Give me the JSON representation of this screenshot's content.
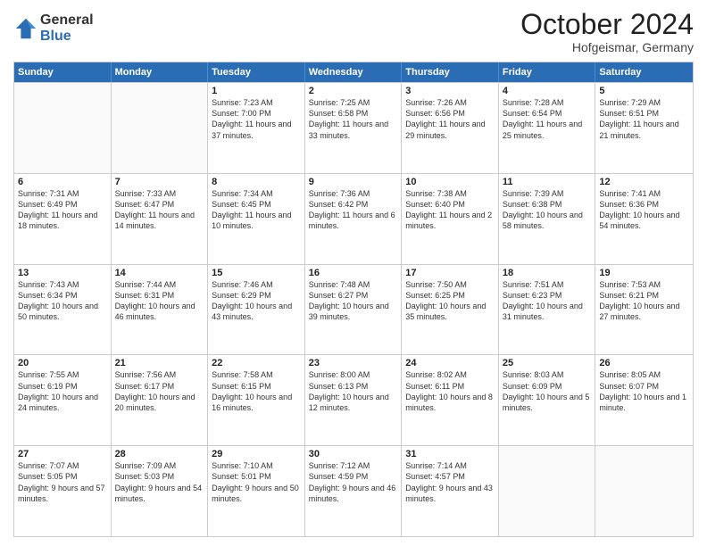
{
  "header": {
    "logo_general": "General",
    "logo_blue": "Blue",
    "title": "October 2024",
    "subtitle": "Hofgeismar, Germany"
  },
  "calendar": {
    "days_of_week": [
      "Sunday",
      "Monday",
      "Tuesday",
      "Wednesday",
      "Thursday",
      "Friday",
      "Saturday"
    ],
    "rows": [
      [
        {
          "day": "",
          "text": "",
          "empty": true
        },
        {
          "day": "",
          "text": "",
          "empty": true
        },
        {
          "day": "1",
          "text": "Sunrise: 7:23 AM\nSunset: 7:00 PM\nDaylight: 11 hours and 37 minutes."
        },
        {
          "day": "2",
          "text": "Sunrise: 7:25 AM\nSunset: 6:58 PM\nDaylight: 11 hours and 33 minutes."
        },
        {
          "day": "3",
          "text": "Sunrise: 7:26 AM\nSunset: 6:56 PM\nDaylight: 11 hours and 29 minutes."
        },
        {
          "day": "4",
          "text": "Sunrise: 7:28 AM\nSunset: 6:54 PM\nDaylight: 11 hours and 25 minutes."
        },
        {
          "day": "5",
          "text": "Sunrise: 7:29 AM\nSunset: 6:51 PM\nDaylight: 11 hours and 21 minutes."
        }
      ],
      [
        {
          "day": "6",
          "text": "Sunrise: 7:31 AM\nSunset: 6:49 PM\nDaylight: 11 hours and 18 minutes."
        },
        {
          "day": "7",
          "text": "Sunrise: 7:33 AM\nSunset: 6:47 PM\nDaylight: 11 hours and 14 minutes."
        },
        {
          "day": "8",
          "text": "Sunrise: 7:34 AM\nSunset: 6:45 PM\nDaylight: 11 hours and 10 minutes."
        },
        {
          "day": "9",
          "text": "Sunrise: 7:36 AM\nSunset: 6:42 PM\nDaylight: 11 hours and 6 minutes."
        },
        {
          "day": "10",
          "text": "Sunrise: 7:38 AM\nSunset: 6:40 PM\nDaylight: 11 hours and 2 minutes."
        },
        {
          "day": "11",
          "text": "Sunrise: 7:39 AM\nSunset: 6:38 PM\nDaylight: 10 hours and 58 minutes."
        },
        {
          "day": "12",
          "text": "Sunrise: 7:41 AM\nSunset: 6:36 PM\nDaylight: 10 hours and 54 minutes."
        }
      ],
      [
        {
          "day": "13",
          "text": "Sunrise: 7:43 AM\nSunset: 6:34 PM\nDaylight: 10 hours and 50 minutes."
        },
        {
          "day": "14",
          "text": "Sunrise: 7:44 AM\nSunset: 6:31 PM\nDaylight: 10 hours and 46 minutes."
        },
        {
          "day": "15",
          "text": "Sunrise: 7:46 AM\nSunset: 6:29 PM\nDaylight: 10 hours and 43 minutes."
        },
        {
          "day": "16",
          "text": "Sunrise: 7:48 AM\nSunset: 6:27 PM\nDaylight: 10 hours and 39 minutes."
        },
        {
          "day": "17",
          "text": "Sunrise: 7:50 AM\nSunset: 6:25 PM\nDaylight: 10 hours and 35 minutes."
        },
        {
          "day": "18",
          "text": "Sunrise: 7:51 AM\nSunset: 6:23 PM\nDaylight: 10 hours and 31 minutes."
        },
        {
          "day": "19",
          "text": "Sunrise: 7:53 AM\nSunset: 6:21 PM\nDaylight: 10 hours and 27 minutes."
        }
      ],
      [
        {
          "day": "20",
          "text": "Sunrise: 7:55 AM\nSunset: 6:19 PM\nDaylight: 10 hours and 24 minutes."
        },
        {
          "day": "21",
          "text": "Sunrise: 7:56 AM\nSunset: 6:17 PM\nDaylight: 10 hours and 20 minutes."
        },
        {
          "day": "22",
          "text": "Sunrise: 7:58 AM\nSunset: 6:15 PM\nDaylight: 10 hours and 16 minutes."
        },
        {
          "day": "23",
          "text": "Sunrise: 8:00 AM\nSunset: 6:13 PM\nDaylight: 10 hours and 12 minutes."
        },
        {
          "day": "24",
          "text": "Sunrise: 8:02 AM\nSunset: 6:11 PM\nDaylight: 10 hours and 8 minutes."
        },
        {
          "day": "25",
          "text": "Sunrise: 8:03 AM\nSunset: 6:09 PM\nDaylight: 10 hours and 5 minutes."
        },
        {
          "day": "26",
          "text": "Sunrise: 8:05 AM\nSunset: 6:07 PM\nDaylight: 10 hours and 1 minute."
        }
      ],
      [
        {
          "day": "27",
          "text": "Sunrise: 7:07 AM\nSunset: 5:05 PM\nDaylight: 9 hours and 57 minutes."
        },
        {
          "day": "28",
          "text": "Sunrise: 7:09 AM\nSunset: 5:03 PM\nDaylight: 9 hours and 54 minutes."
        },
        {
          "day": "29",
          "text": "Sunrise: 7:10 AM\nSunset: 5:01 PM\nDaylight: 9 hours and 50 minutes."
        },
        {
          "day": "30",
          "text": "Sunrise: 7:12 AM\nSunset: 4:59 PM\nDaylight: 9 hours and 46 minutes."
        },
        {
          "day": "31",
          "text": "Sunrise: 7:14 AM\nSunset: 4:57 PM\nDaylight: 9 hours and 43 minutes."
        },
        {
          "day": "",
          "text": "",
          "empty": true
        },
        {
          "day": "",
          "text": "",
          "empty": true
        }
      ]
    ]
  }
}
